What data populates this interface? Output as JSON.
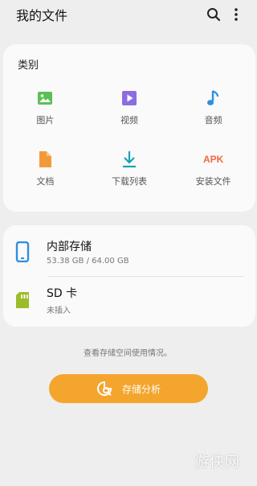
{
  "header": {
    "title": "我的文件"
  },
  "categories": {
    "title": "类别",
    "items": [
      {
        "label": "图片",
        "icon": "image-icon",
        "color": "#5bbf55"
      },
      {
        "label": "视频",
        "icon": "video-icon",
        "color": "#8a6ee0"
      },
      {
        "label": "音频",
        "icon": "music-icon",
        "color": "#2f8fe0"
      },
      {
        "label": "文档",
        "icon": "document-icon",
        "color": "#f29a3a"
      },
      {
        "label": "下载列表",
        "icon": "download-icon",
        "color": "#17a2b8"
      },
      {
        "label": "安装文件",
        "icon": "apk-icon",
        "color": "#f06a3a",
        "icon_text": "APK"
      }
    ]
  },
  "storage": [
    {
      "name": "内部存储",
      "detail": "53.38 GB / 64.00 GB",
      "icon": "phone-icon",
      "color": "#2f8fe0"
    },
    {
      "name": "SD 卡",
      "detail": "未插入",
      "icon": "sd-card-icon",
      "color": "#9bbd2a"
    }
  ],
  "hint": "查看存储空间使用情况。",
  "analyze_button": {
    "label": "存储分析",
    "color": "#f4a52d"
  },
  "watermark": "游侠网"
}
